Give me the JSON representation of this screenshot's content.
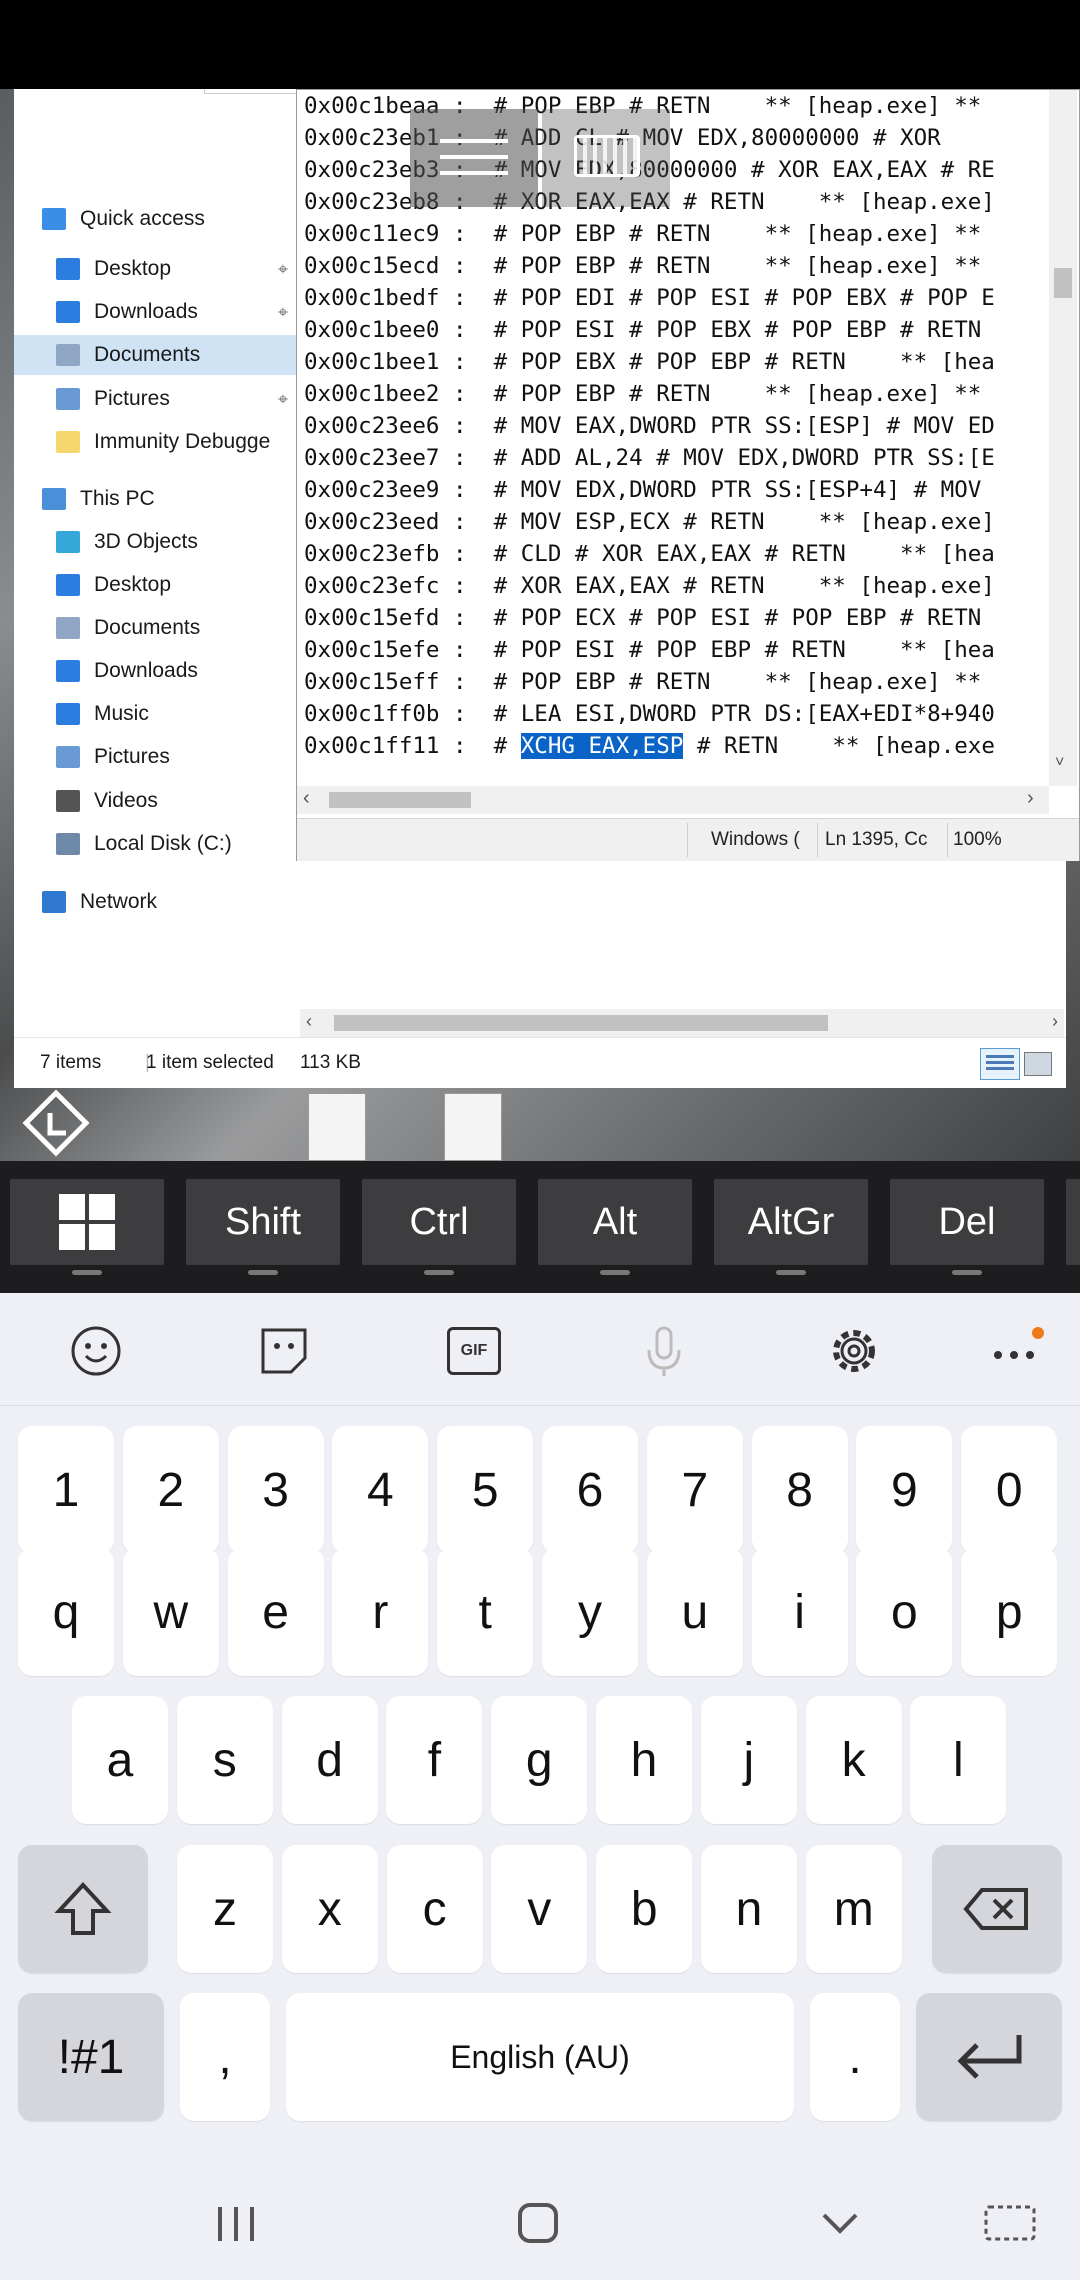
{
  "explorer": {
    "nav_items": [
      {
        "label": "Quick access",
        "icon": "star-icon"
      },
      {
        "label": "Desktop",
        "icon": "desktop-folder-icon",
        "pinned": true
      },
      {
        "label": "Downloads",
        "icon": "download-folder-icon",
        "pinned": true
      },
      {
        "label": "Documents",
        "icon": "documents-folder-icon",
        "pinned": true,
        "selected": true
      },
      {
        "label": "Pictures",
        "icon": "pictures-folder-icon",
        "pinned": true
      },
      {
        "label": "Immunity Debugge",
        "icon": "folder-icon"
      },
      {
        "label": "This PC",
        "icon": "computer-icon"
      },
      {
        "label": "3D Objects",
        "icon": "3d-objects-icon"
      },
      {
        "label": "Desktop",
        "icon": "desktop-folder-icon"
      },
      {
        "label": "Documents",
        "icon": "documents-folder-icon"
      },
      {
        "label": "Downloads",
        "icon": "download-folder-icon"
      },
      {
        "label": "Music",
        "icon": "music-icon"
      },
      {
        "label": "Pictures",
        "icon": "pictures-folder-icon"
      },
      {
        "label": "Videos",
        "icon": "videos-icon"
      },
      {
        "label": "Local Disk (C:)",
        "icon": "disk-icon"
      },
      {
        "label": "Network",
        "icon": "network-icon"
      }
    ],
    "status": {
      "items": "7 items",
      "selected": "1 item selected",
      "size": "113 KB"
    }
  },
  "notepad": {
    "lines": [
      {
        "addr": "0x00c1beaa",
        "text": " :  # POP EBP # RETN    ** [heap.exe] **"
      },
      {
        "addr": "0x00c23eb1",
        "text": " :  # ADD CL # MOV EDX,80000000 # XOR "
      },
      {
        "addr": "0x00c23eb3",
        "text": " :  # MOV EDX,80000000 # XOR EAX,EAX # RE"
      },
      {
        "addr": "0x00c23eb8",
        "text": " :  # XOR EAX,EAX # RETN    ** [heap.exe]"
      },
      {
        "addr": "0x00c11ec9",
        "text": " :  # POP EBP # RETN    ** [heap.exe] **"
      },
      {
        "addr": "0x00c15ecd",
        "text": " :  # POP EBP # RETN    ** [heap.exe] **"
      },
      {
        "addr": "0x00c1bedf",
        "text": " :  # POP EDI # POP ESI # POP EBX # POP E"
      },
      {
        "addr": "0x00c1bee0",
        "text": " :  # POP ESI # POP EBX # POP EBP # RETN"
      },
      {
        "addr": "0x00c1bee1",
        "text": " :  # POP EBX # POP EBP # RETN    ** [hea"
      },
      {
        "addr": "0x00c1bee2",
        "text": " :  # POP EBP # RETN    ** [heap.exe] **"
      },
      {
        "addr": "0x00c23ee6",
        "text": " :  # MOV EAX,DWORD PTR SS:[ESP] # MOV ED"
      },
      {
        "addr": "0x00c23ee7",
        "text": " :  # ADD AL,24 # MOV EDX,DWORD PTR SS:[E"
      },
      {
        "addr": "0x00c23ee9",
        "text": " :  # MOV EDX,DWORD PTR SS:[ESP+4] # MOV "
      },
      {
        "addr": "0x00c23eed",
        "text": " :  # MOV ESP,ECX # RETN    ** [heap.exe]"
      },
      {
        "addr": "0x00c23efb",
        "text": " :  # CLD # XOR EAX,EAX # RETN    ** [hea"
      },
      {
        "addr": "0x00c23efc",
        "text": " :  # XOR EAX,EAX # RETN    ** [heap.exe]"
      },
      {
        "addr": "0x00c15efd",
        "text": " :  # POP ECX # POP ESI # POP EBP # RETN"
      },
      {
        "addr": "0x00c15efe",
        "text": " :  # POP ESI # POP EBP # RETN    ** [hea"
      },
      {
        "addr": "0x00c15eff",
        "text": " :  # POP EBP # RETN    ** [heap.exe] **"
      },
      {
        "addr": "0x00c1ff0b",
        "text": " :  # LEA ESI,DWORD PTR DS:[EAX+EDI*8+940"
      }
    ],
    "last_line": {
      "addr": "0x00c1ff11",
      "before": " :  # ",
      "selected": "XCHG EAX,ESP",
      "after": " # RETN    ** [heap.exe"
    },
    "status": {
      "encoding": "Windows (",
      "position": "Ln 1395, Cc",
      "zoom": "100%"
    }
  },
  "extra_keys": [
    "Shift",
    "Ctrl",
    "Alt",
    "AltGr",
    "Del"
  ],
  "keyboard": {
    "numbers": [
      "1",
      "2",
      "3",
      "4",
      "5",
      "6",
      "7",
      "8",
      "9",
      "0"
    ],
    "row1": [
      "q",
      "w",
      "e",
      "r",
      "t",
      "y",
      "u",
      "i",
      "o",
      "p"
    ],
    "row2": [
      "a",
      "s",
      "d",
      "f",
      "g",
      "h",
      "j",
      "k",
      "l"
    ],
    "row3": [
      "z",
      "x",
      "c",
      "v",
      "b",
      "n",
      "m"
    ],
    "symbols_label": "!#1",
    "comma": ",",
    "space_label": "English (AU)",
    "period": ".",
    "gif_label": "GIF"
  }
}
